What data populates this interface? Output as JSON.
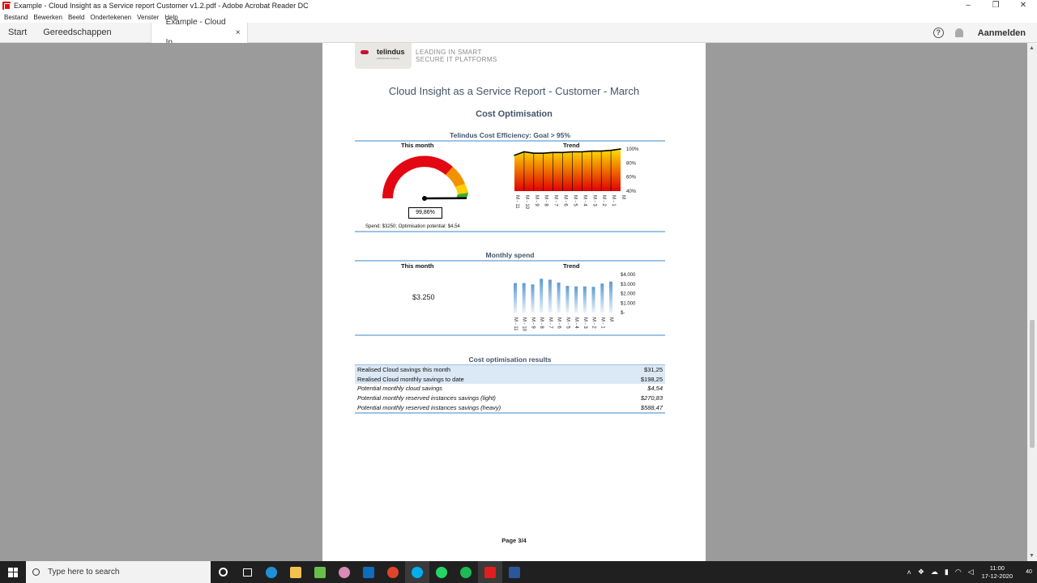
{
  "window": {
    "title": "Example - Cloud Insight as a Service report Customer v1.2.pdf - Adobe Acrobat Reader DC",
    "controls": [
      "–",
      "❐",
      "✕"
    ]
  },
  "menu": [
    "Bestand",
    "Bewerken",
    "Beeld",
    "Ondertekenen",
    "Venster",
    "Help"
  ],
  "tabs": {
    "start": "Start",
    "tools": "Gereedschappen",
    "document": "Example - Cloud In...",
    "close": "×"
  },
  "header_right": {
    "help": "?",
    "signin": "Aanmelden"
  },
  "document": {
    "logo": {
      "name": "telindus",
      "sub": "a Proximus company"
    },
    "tagline": [
      "LEADING IN SMART",
      "SECURE IT PLATFORMS"
    ],
    "report_title": "Cloud Insight as a Service Report - Customer - March",
    "section_title": "Cost Optimisation",
    "efficiency": {
      "title": "Telindus Cost Efficiency: Goal > 95%",
      "this_month_label": "This month",
      "trend_label": "Trend",
      "value": "99,86%",
      "gauge_fraction": 0.9986,
      "note": "Spend: $3250; Optimisation potential: $4,54"
    },
    "monthly_spend": {
      "title": "Monthly spend",
      "this_month_label": "This month",
      "trend_label": "Trend",
      "value": "$3.250"
    },
    "results": {
      "title": "Cost optimisation results",
      "rows": [
        {
          "label": "Realised  Cloud savings this month",
          "value": "$31,25",
          "style": "highlight"
        },
        {
          "label": "Realised Cloud monthly savings to date",
          "value": "$198,25",
          "style": "highlight"
        },
        {
          "label": "Potential monthly cloud savings",
          "value": "$4,54",
          "style": "italic"
        },
        {
          "label": "Potential monthly reserved instances savings (light)",
          "value": "$270,83",
          "style": "italic"
        },
        {
          "label": "Potential monthly reserved instances savings (heavy)",
          "value": "$588,47",
          "style": "italic"
        }
      ]
    },
    "page_number": "Page 3/4"
  },
  "chart_data": [
    {
      "type": "area",
      "categories": [
        "M - 11",
        "M - 10",
        "M - 9",
        "M - 8",
        "M - 7",
        "M - 6",
        "M - 5",
        "M - 4",
        "M - 3",
        "M - 2",
        "M - 1",
        "M"
      ],
      "values": [
        91,
        96,
        94,
        94,
        95,
        95,
        96,
        96,
        97,
        97,
        98,
        100
      ],
      "ylim": [
        40,
        100
      ],
      "ytick_labels": [
        "100%",
        "80%",
        "60%",
        "40%"
      ],
      "ytick_values": [
        100,
        80,
        60,
        40
      ],
      "colors": {
        "top": "#ffe000",
        "bottom": "#e00000",
        "line": "#000000"
      }
    },
    {
      "type": "bar",
      "categories": [
        "M - 11",
        "M - 10",
        "M - 9",
        "M - 8",
        "M - 7",
        "M - 6",
        "M - 5",
        "M - 4",
        "M - 3",
        "M - 2",
        "M - 1",
        "M"
      ],
      "values": [
        3100,
        3100,
        2950,
        3550,
        3450,
        3150,
        2800,
        2750,
        2750,
        2700,
        3050,
        3250
      ],
      "ylim": [
        0,
        4000
      ],
      "ytick_labels": [
        "$4.000",
        "$3.000",
        "$2.000",
        "$1.000",
        "$-"
      ],
      "ytick_values": [
        4000,
        3000,
        2000,
        1000,
        0
      ],
      "colors": {
        "top": "#5b9bd5",
        "bottom": "#eaf2fa"
      }
    }
  ],
  "taskbar": {
    "search_placeholder": "Type here to search",
    "time": "11:00",
    "date": "17-12-2020",
    "notification_count": "40"
  }
}
